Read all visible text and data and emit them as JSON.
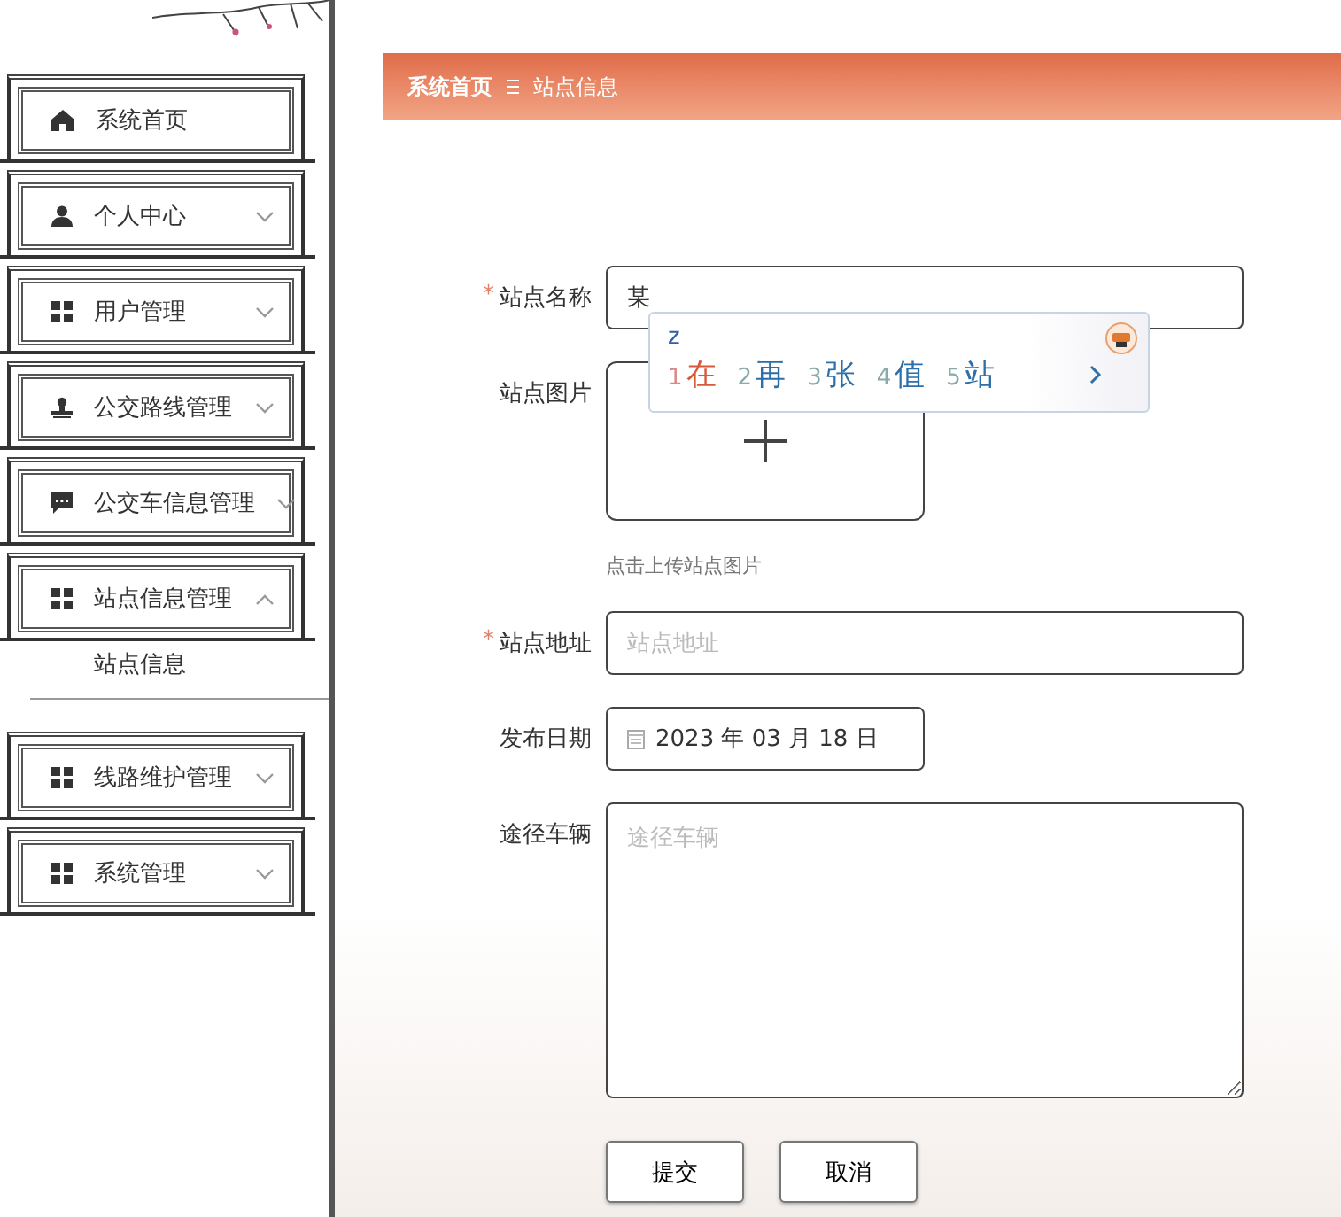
{
  "sidebar": {
    "items": [
      {
        "label": "系统首页",
        "kind": "link"
      },
      {
        "label": "个人中心",
        "kind": "group",
        "expanded": false
      },
      {
        "label": "用户管理",
        "kind": "group",
        "expanded": false
      },
      {
        "label": "公交路线管理",
        "kind": "group",
        "expanded": false
      },
      {
        "label": "公交车信息管理",
        "kind": "group",
        "expanded": false
      },
      {
        "label": "站点信息管理",
        "kind": "group",
        "expanded": true,
        "children": [
          {
            "label": "站点信息"
          }
        ]
      },
      {
        "label": "线路维护管理",
        "kind": "group",
        "expanded": false
      },
      {
        "label": "系统管理",
        "kind": "group",
        "expanded": false
      }
    ]
  },
  "breadcrumb": [
    "系统首页",
    "站点信息"
  ],
  "form": {
    "fields": [
      {
        "kind": "text",
        "label": "站点名称",
        "required_mark": "*",
        "value": "某"
      },
      {
        "kind": "upload",
        "label": "站点图片",
        "hint": "点击上传站点图片"
      },
      {
        "kind": "text",
        "label": "站点地址",
        "required_mark": "*",
        "placeholder": "站点地址"
      },
      {
        "kind": "date",
        "label": "发布日期",
        "value": "2023 年 03 月 18 日"
      },
      {
        "kind": "textarea",
        "label": "途径车辆",
        "placeholder": "途径车辆"
      }
    ],
    "buttons": [
      "提交",
      "取消"
    ]
  },
  "ime": {
    "composition": "z",
    "candidates": [
      {
        "number": "1",
        "text": "在",
        "selected": true
      },
      {
        "number": "2",
        "text": "再",
        "selected": false
      },
      {
        "number": "3",
        "text": "张",
        "selected": false
      },
      {
        "number": "4",
        "text": "值",
        "selected": false
      },
      {
        "number": "5",
        "text": "站",
        "selected": false
      }
    ]
  }
}
